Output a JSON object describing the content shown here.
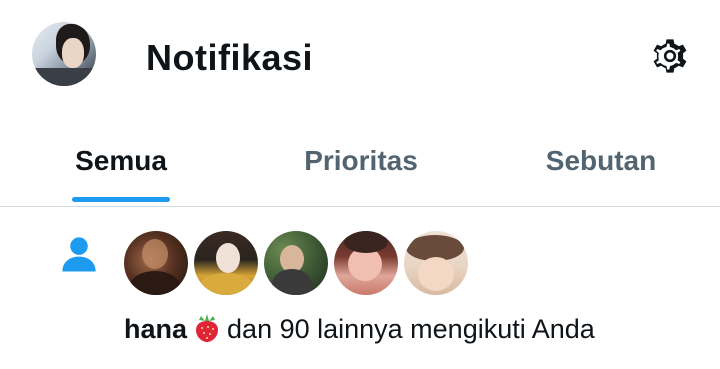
{
  "header": {
    "title": "Notifikasi",
    "avatar_icon": "profile-avatar",
    "settings_icon": "gear-icon"
  },
  "tabs": [
    {
      "label": "Semua",
      "active": true
    },
    {
      "label": "Prioritas",
      "active": false
    },
    {
      "label": "Sebutan",
      "active": false
    }
  ],
  "notification": {
    "type_icon": "person-icon",
    "follower_avatars": [
      {
        "name": "follower-avatar-1"
      },
      {
        "name": "follower-avatar-2"
      },
      {
        "name": "follower-avatar-3"
      },
      {
        "name": "follower-avatar-4"
      },
      {
        "name": "follower-avatar-5"
      }
    ],
    "username": "hana",
    "username_emoji": "strawberry-emoji",
    "text": "dan 90 lainnya mengikuti Anda"
  },
  "colors": {
    "accent": "#1d9bf0",
    "text_primary": "#0f1419",
    "text_secondary": "#536471",
    "divider": "#cfd9de"
  }
}
